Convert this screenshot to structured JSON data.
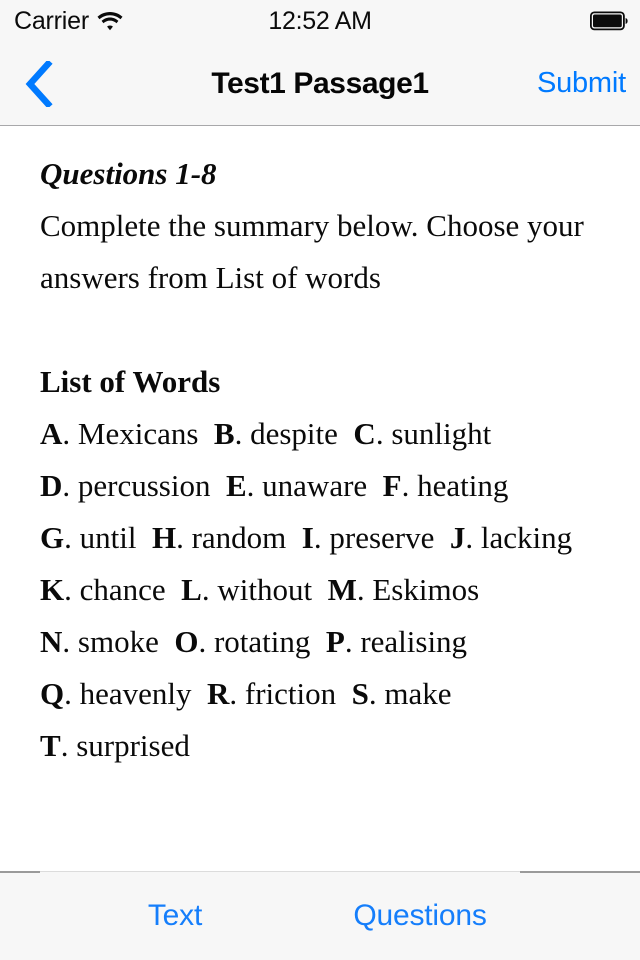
{
  "status_bar": {
    "carrier": "Carrier",
    "wifi_icon": "wifi-icon",
    "time": "12:52 AM",
    "battery_icon": "battery-full-icon"
  },
  "nav_bar": {
    "back_icon": "chevron-left-icon",
    "title": "Test1 Passage1",
    "submit_label": "Submit"
  },
  "content": {
    "heading": "Questions 1-8",
    "instructions": "Complete the summary below. Choose your answers from List of words",
    "list_heading": "List of Words",
    "options": [
      {
        "letter": "A",
        "word": "Mexicans"
      },
      {
        "letter": "B",
        "word": "despite"
      },
      {
        "letter": "C",
        "word": "sunlight"
      },
      {
        "letter": "D",
        "word": "percussion"
      },
      {
        "letter": "E",
        "word": "unaware"
      },
      {
        "letter": "F",
        "word": "heating"
      },
      {
        "letter": "G",
        "word": "until"
      },
      {
        "letter": "H",
        "word": "random"
      },
      {
        "letter": "I",
        "word": "preserve"
      },
      {
        "letter": "J",
        "word": "lacking"
      },
      {
        "letter": "K",
        "word": "chance"
      },
      {
        "letter": "L",
        "word": "without"
      },
      {
        "letter": "M",
        "word": "Eskimos"
      },
      {
        "letter": "N",
        "word": "smoke"
      },
      {
        "letter": "O",
        "word": "rotating"
      },
      {
        "letter": "P",
        "word": "realising"
      },
      {
        "letter": "Q",
        "word": "heavenly"
      },
      {
        "letter": "R",
        "word": "friction"
      },
      {
        "letter": "S",
        "word": "make"
      },
      {
        "letter": "T",
        "word": "surprised"
      }
    ]
  },
  "toolbar": {
    "text_label": "Text",
    "questions_label": "Questions"
  },
  "colors": {
    "accent_blue": "#007aff",
    "toolbar_blue": "#157efb",
    "bar_background": "#f7f7f7",
    "content_background": "#ffffff",
    "text_black": "#0a0a0a"
  }
}
